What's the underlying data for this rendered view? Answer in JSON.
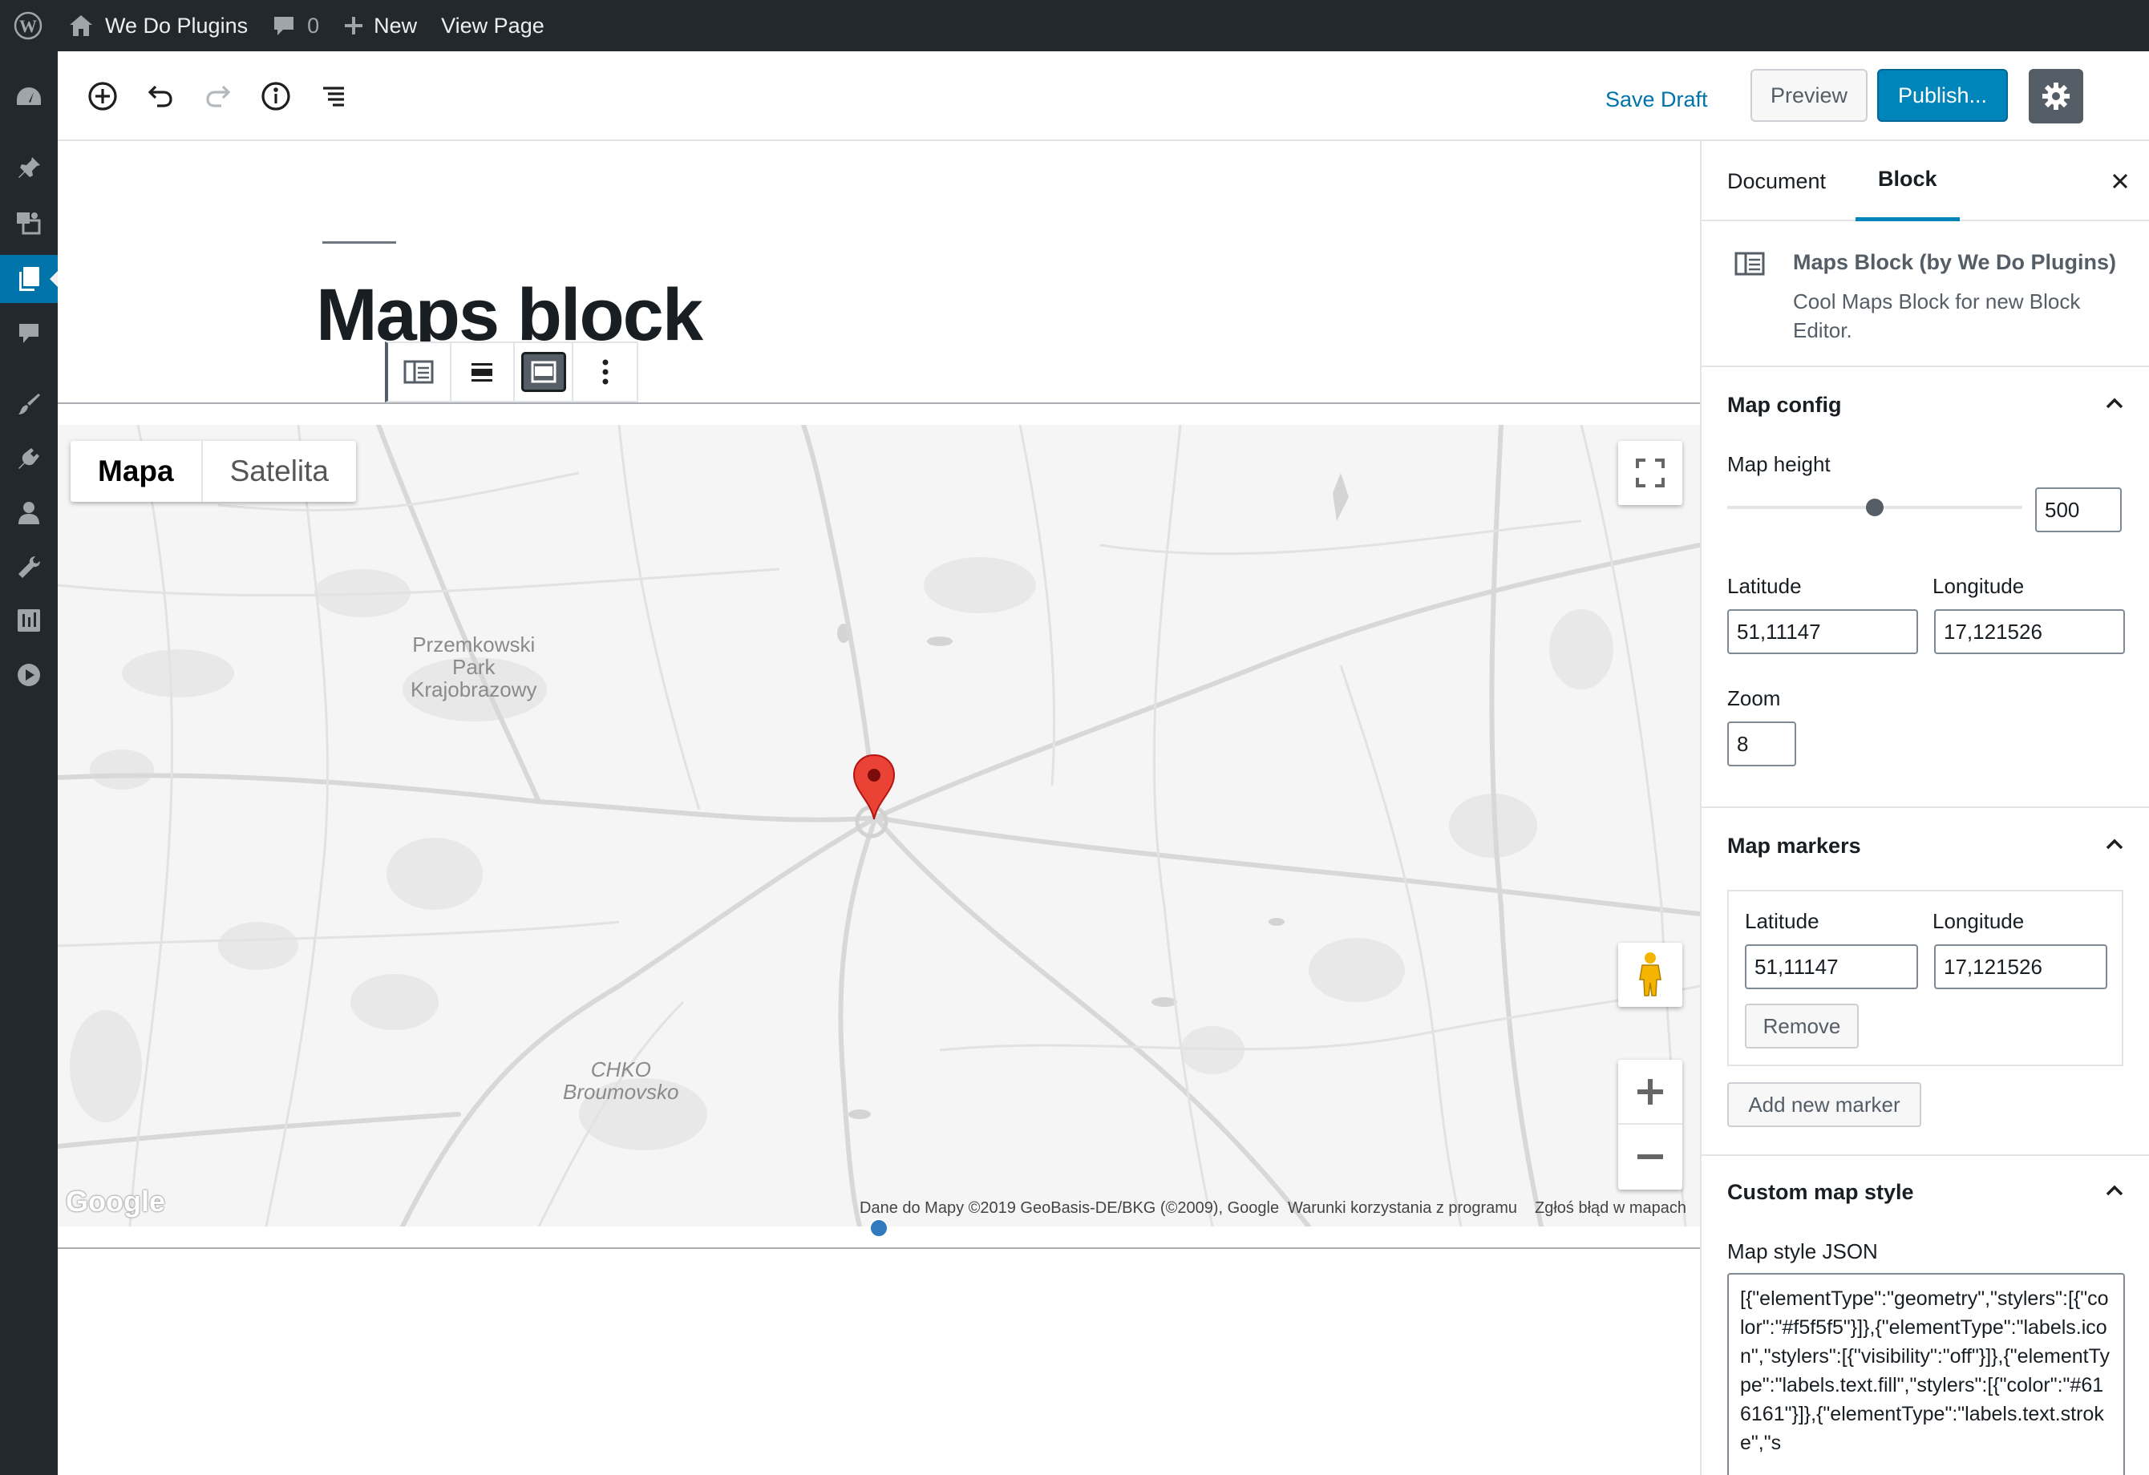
{
  "adminbar": {
    "site_name": "We Do Plugins",
    "comments_count": "0",
    "new_label": "New",
    "view_page_label": "View Page"
  },
  "header": {
    "save_draft": "Save Draft",
    "preview": "Preview",
    "publish": "Publish..."
  },
  "post": {
    "title": "Maps block"
  },
  "map": {
    "type_map": "Mapa",
    "type_satellite": "Satelita",
    "labels": {
      "park_line1": "Przemkowski",
      "park_line2": "Park",
      "park_line3": "Krajobrazowy",
      "chko_line1": "CHKO",
      "chko_line2": "Broumovsko"
    },
    "google": "Google",
    "attribution": "Dane do Mapy ©2019 GeoBasis-DE/BKG (©2009), Google",
    "terms": "Warunki korzystania z programu",
    "report": "Zgłoś błąd w mapach"
  },
  "sidebar": {
    "tab_document": "Document",
    "tab_block": "Block",
    "block_name": "Maps Block (by We Do Plugins)",
    "block_desc": "Cool Maps Block for new Block Editor.",
    "map_config": {
      "title": "Map config",
      "height_label": "Map height",
      "height_value": "500",
      "height_fraction": 0.5,
      "latitude_label": "Latitude",
      "latitude_value": "51,11147",
      "longitude_label": "Longitude",
      "longitude_value": "17,121526",
      "zoom_label": "Zoom",
      "zoom_value": "8"
    },
    "map_markers": {
      "title": "Map markers",
      "latitude_label": "Latitude",
      "latitude_value": "51,11147",
      "longitude_label": "Longitude",
      "longitude_value": "17,121526",
      "remove": "Remove",
      "add_new": "Add new marker"
    },
    "custom_style": {
      "title": "Custom map style",
      "json_label": "Map style JSON",
      "json_value": "[{\"elementType\":\"geometry\",\"stylers\":[{\"color\":\"#f5f5f5\"}]},{\"elementType\":\"labels.icon\",\"stylers\":[{\"visibility\":\"off\"}]},{\"elementType\":\"labels.text.fill\",\"stylers\":[{\"color\":\"#616161\"}]},{\"elementType\":\"labels.text.stroke\",\"s"
    }
  },
  "colors": {
    "admin_dark": "#23282d",
    "accent": "#0085ba",
    "marker_red": "#db4437"
  }
}
